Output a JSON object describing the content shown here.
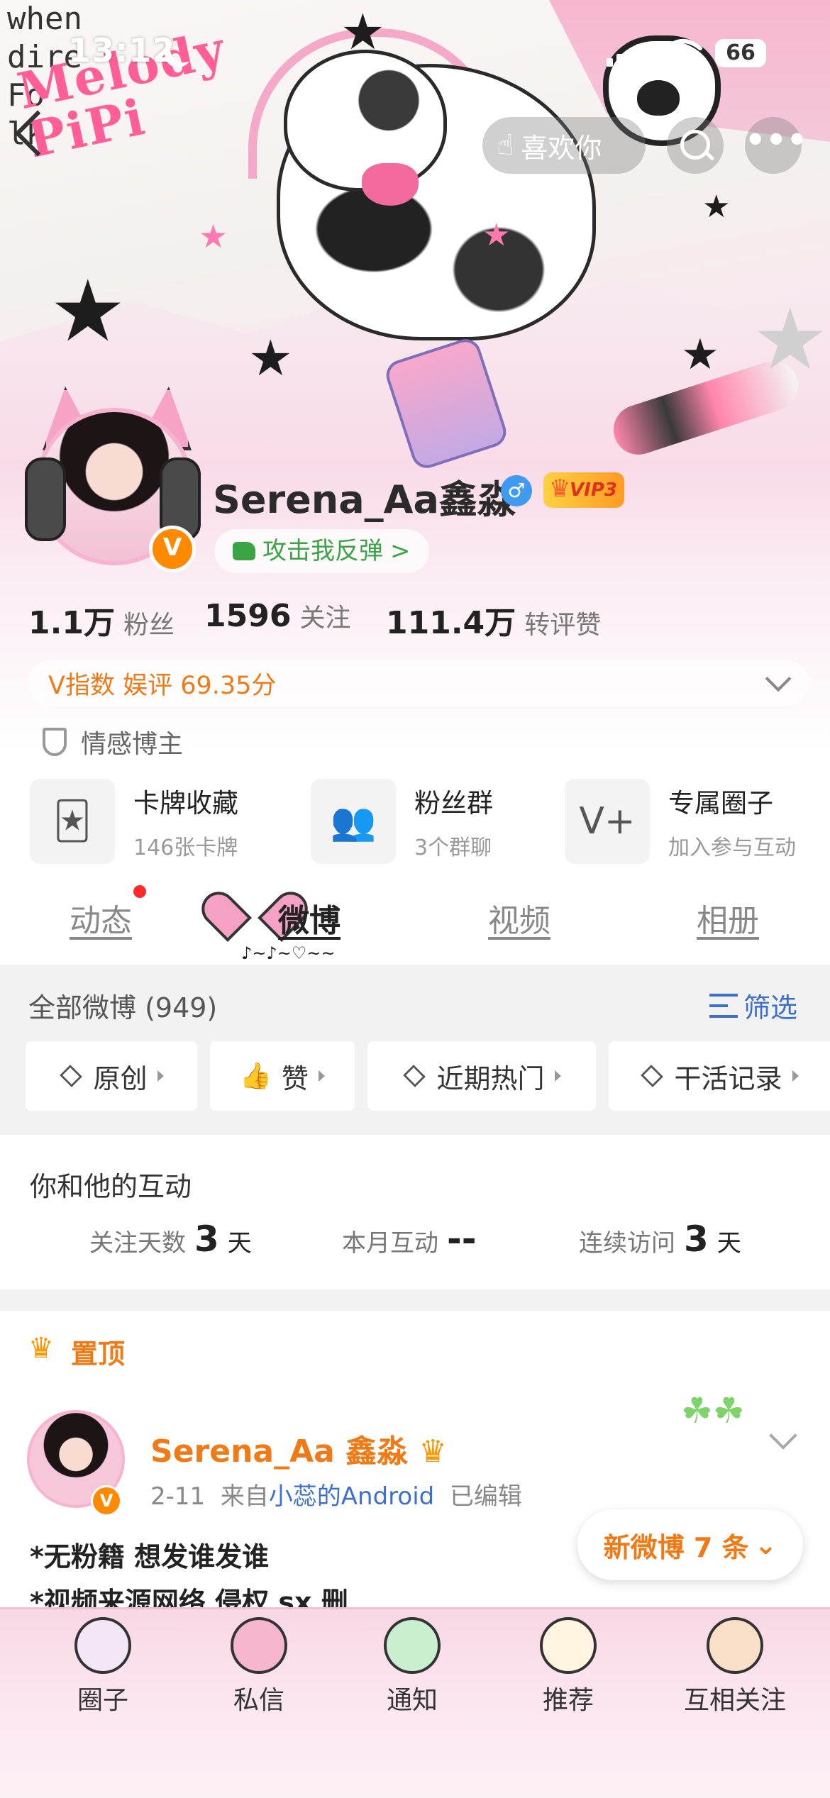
{
  "status_bar": {
    "time": "13:12",
    "battery": "66"
  },
  "header": {
    "banner_text": "Melody PiPi",
    "like_button": "喜欢你",
    "more_label": "•••"
  },
  "profile": {
    "username": "Serena_Aa鑫淼",
    "vip_label": "VIP3",
    "gender": "♂",
    "verified_label": "V",
    "tagline": "攻击我反弹",
    "tagline_arrow": ">",
    "stats": [
      {
        "num": "1.1万",
        "label": "粉丝"
      },
      {
        "num": "1596",
        "label": "关注"
      },
      {
        "num": "111.4万",
        "label": "转评赞"
      }
    ],
    "v_index": "V指数 娱评 69.35分",
    "tag": "情感博主"
  },
  "features": [
    {
      "title": "卡牌收藏",
      "sub": "146张卡牌",
      "icon": "card-icon"
    },
    {
      "title": "粉丝群",
      "sub": "3个群聊",
      "icon": "group-icon"
    },
    {
      "title": "专属圈子",
      "sub": "加入参与互动",
      "icon": "circle-add-icon"
    }
  ],
  "tabs": [
    {
      "label": "动态"
    },
    {
      "label": "微博"
    },
    {
      "label": "视频"
    },
    {
      "label": "相册"
    }
  ],
  "weibo_section": {
    "all_label": "全部微博 (949)",
    "filter": "筛选",
    "chips": [
      "原创",
      "赞",
      "近期热门",
      "干活记录"
    ]
  },
  "interaction": {
    "title": "你和他的互动",
    "items": [
      {
        "label": "关注天数",
        "value": "3",
        "unit": "天"
      },
      {
        "label": "本月互动",
        "value": "--",
        "unit": ""
      },
      {
        "label": "连续访问",
        "value": "3",
        "unit": "天"
      }
    ]
  },
  "pinned": {
    "label": "置顶",
    "name": "Serena_Aa 鑫淼",
    "date": "2-11",
    "from": "来自",
    "source": "小蕊的Android",
    "edited": "已编辑",
    "lines": [
      "*无粉籍 想发谁发谁",
      "*视频来源网络 侵权 sx 删"
    ]
  },
  "new_posts": "新微博 7 条",
  "bottom_nav": [
    {
      "label": "圈子",
      "icon": "microphone-icon"
    },
    {
      "label": "私信",
      "icon": "heart-icon"
    },
    {
      "label": "通知",
      "icon": "tamagotchi-icon"
    },
    {
      "label": "推荐",
      "icon": "bonnet-icon"
    },
    {
      "label": "互相关注",
      "icon": "paw-icon"
    }
  ]
}
